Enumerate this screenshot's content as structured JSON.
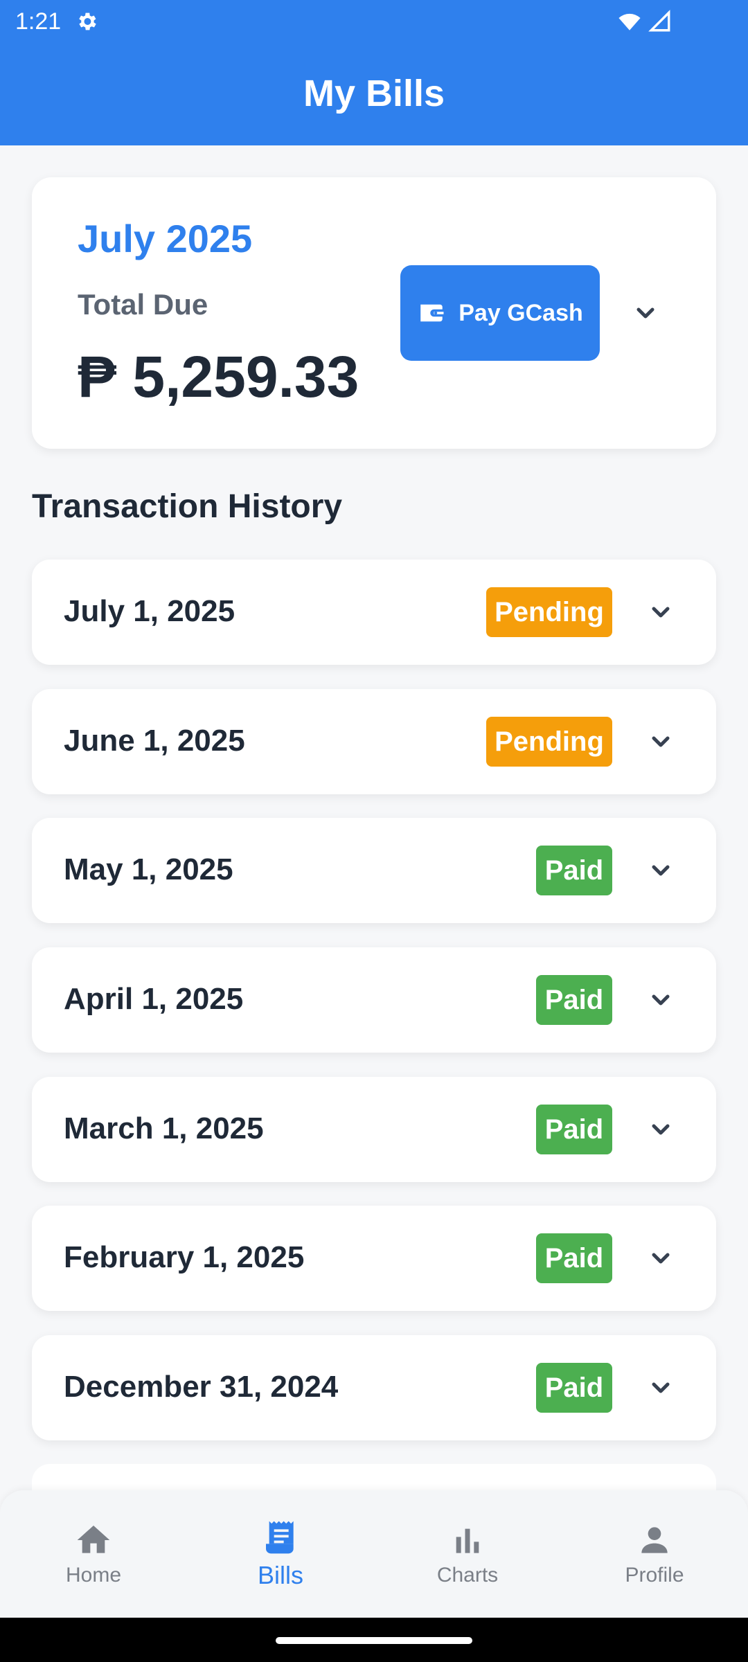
{
  "status_bar": {
    "time": "1:21"
  },
  "app_bar": {
    "title": "My Bills"
  },
  "summary": {
    "month": "July 2025",
    "label": "Total Due",
    "amount": "₱ 5,259.33",
    "pay_button_label": "Pay GCash"
  },
  "history": {
    "title": "Transaction History",
    "rows": [
      {
        "date": "July 1, 2025",
        "status": "Pending"
      },
      {
        "date": "June 1, 2025",
        "status": "Pending"
      },
      {
        "date": "May 1, 2025",
        "status": "Paid"
      },
      {
        "date": "April 1, 2025",
        "status": "Paid"
      },
      {
        "date": "March 1, 2025",
        "status": "Paid"
      },
      {
        "date": "February 1, 2025",
        "status": "Paid"
      },
      {
        "date": "December 31, 2024",
        "status": "Paid"
      }
    ]
  },
  "nav": {
    "items": [
      {
        "label": "Home",
        "icon": "home-icon"
      },
      {
        "label": "Bills",
        "icon": "receipt-icon",
        "active": true
      },
      {
        "label": "Charts",
        "icon": "bar-chart-icon"
      },
      {
        "label": "Profile",
        "icon": "person-icon"
      }
    ]
  },
  "colors": {
    "primary": "#2f80ed",
    "pending": "#f59e0b",
    "paid": "#4caf50",
    "text": "#1f2937"
  }
}
